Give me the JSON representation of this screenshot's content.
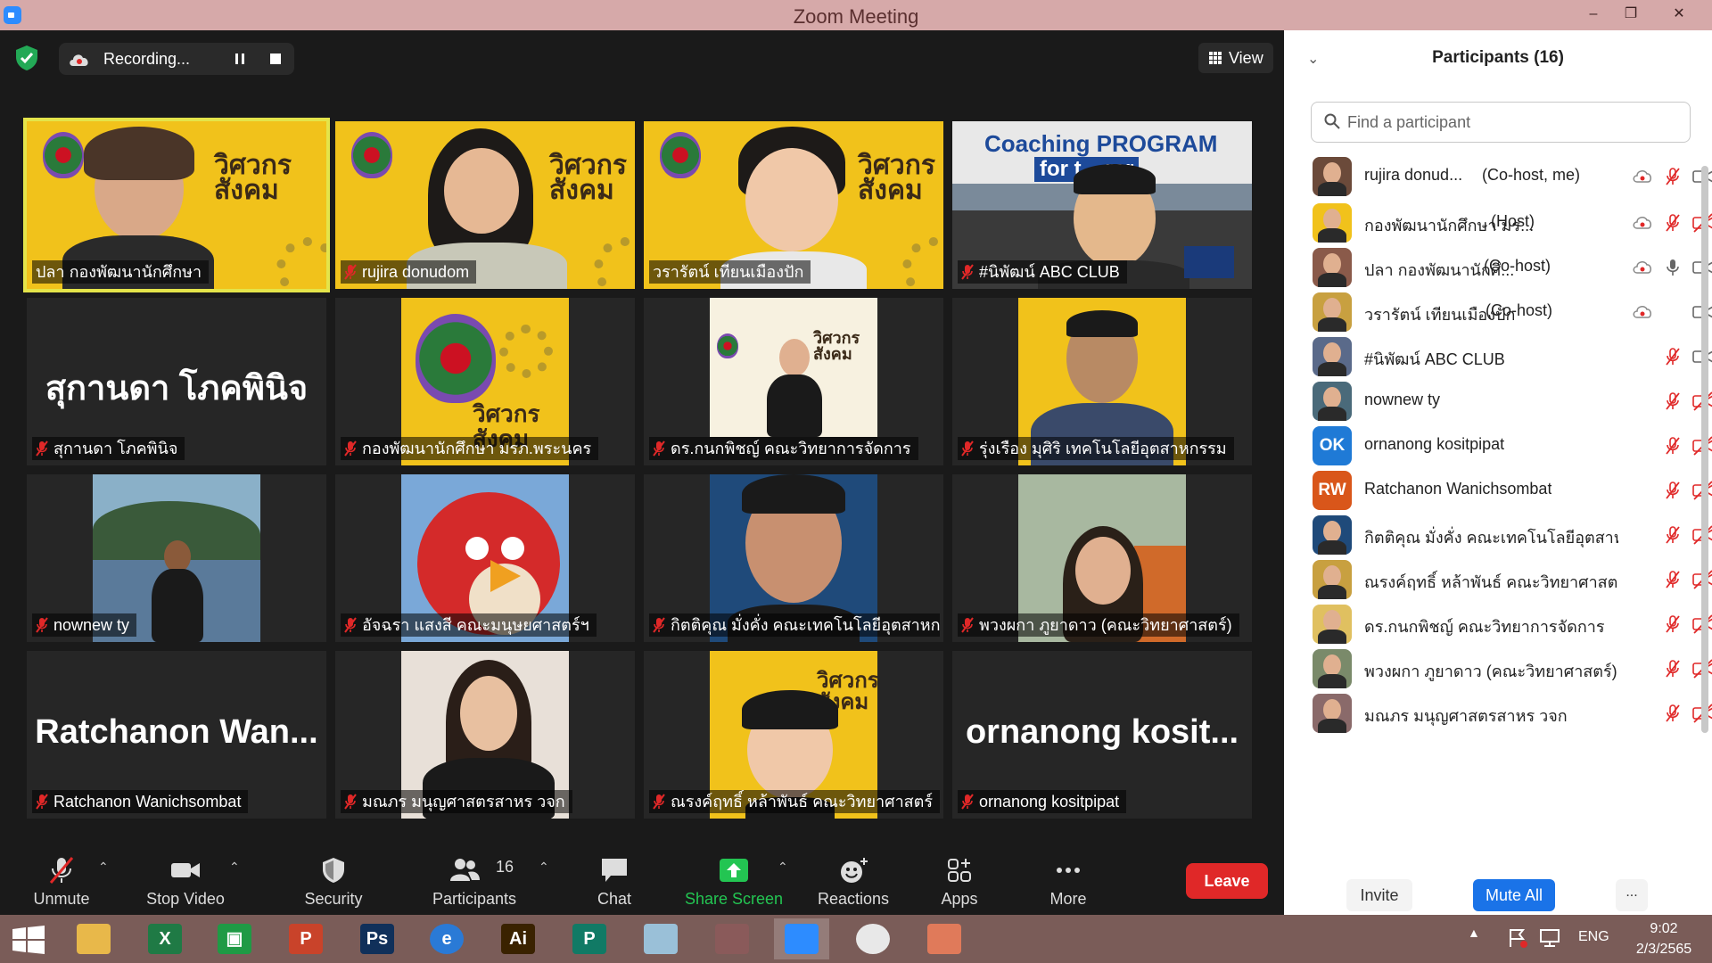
{
  "window": {
    "title": "Zoom Meeting",
    "controls": [
      "–",
      "❐",
      "✕"
    ]
  },
  "top_bar": {
    "recording_label": "Recording...",
    "view_label": "View"
  },
  "tiles": [
    {
      "name": "ปลา กองพัฒนานักศึกษา",
      "mic": "on",
      "active": true
    },
    {
      "name": "rujira donudom",
      "mic": "muted"
    },
    {
      "name": "วรารัตน์ เทียนเมืองปัก",
      "mic": "on"
    },
    {
      "name": "#นิพัฒน์ ABC CLUB",
      "mic": "muted",
      "banner": "Coaching PROGRAM",
      "banner2": "for t    rer"
    },
    {
      "name": "สุกานดา โภคพินิจ",
      "mic": "muted",
      "big": "สุกานดา โภคพินิจ"
    },
    {
      "name": "กองพัฒนานักศึกษา มรภ.พระนคร",
      "mic": "muted"
    },
    {
      "name": "ดร.กนกพิชญ์ คณะวิทยาการจัดการ",
      "mic": "muted"
    },
    {
      "name": "รุ่งเรือง มุศิริ เทคโนโลยีอุตสาหกรรม",
      "mic": "muted"
    },
    {
      "name": "nownew ty",
      "mic": "muted"
    },
    {
      "name": "อัจฉรา แสงสี คณะมนุษยศาสตร์ฯ",
      "mic": "muted"
    },
    {
      "name": "กิตติคุณ มั่งคั่ง คณะเทคโนโลยีอุตสาหกรรม",
      "mic": "muted"
    },
    {
      "name": "พวงผกา ภูยาดาว (คณะวิทยาศาสตร์)",
      "mic": "muted"
    },
    {
      "name": "Ratchanon Wanichsombat",
      "mic": "muted",
      "big": "Ratchanon  Wan..."
    },
    {
      "name": "มณภร มนุญศาสตรสาหร วจก",
      "mic": "muted"
    },
    {
      "name": "ณรงค์ฤทธิ์ หล้าพันธ์ คณะวิทยาศาสตร์",
      "mic": "muted"
    },
    {
      "name": "ornanong kositpipat",
      "mic": "muted",
      "big": "ornanong  kosit..."
    }
  ],
  "banner_text": {
    "line1": "วิศวกร",
    "line2": "สังคม"
  },
  "toolbar": {
    "unmute": "Unmute",
    "stop_video": "Stop Video",
    "security": "Security",
    "participants": "Participants",
    "participants_count": "16",
    "chat": "Chat",
    "share_screen": "Share Screen",
    "reactions": "Reactions",
    "apps": "Apps",
    "more": "More",
    "leave": "Leave"
  },
  "panel": {
    "title": "Participants (16)",
    "search_placeholder": "Find a participant",
    "invite": "Invite",
    "mute_all": "Mute All",
    "more": "...",
    "participants": [
      {
        "name": "rujira donud...",
        "role": "(Co-host, me)",
        "cloud": true,
        "mic": "muted",
        "video": "on",
        "avatar": "photo",
        "color": "#6b4a3a"
      },
      {
        "name": "กองพัฒนานักศึกษา มร...",
        "role": "(Host)",
        "cloud": true,
        "mic": "muted",
        "video": "off",
        "avatar": "crest",
        "color": "#f1c21b"
      },
      {
        "name": "ปลา กองพัฒนานักศึ...",
        "role": "(Co-host)",
        "cloud": true,
        "mic": "on",
        "video": "on",
        "avatar": "photo",
        "color": "#8a5a4a"
      },
      {
        "name": "วรารัตน์ เทียนเมืองปัก",
        "role": "(Co-host)",
        "cloud": true,
        "mic": "none",
        "video": "on",
        "avatar": "photo",
        "color": "#c8a040"
      },
      {
        "name": "#นิพัฒน์ ABC CLUB",
        "role": "",
        "cloud": false,
        "mic": "muted",
        "video": "on",
        "avatar": "photo",
        "color": "#5a6a8a"
      },
      {
        "name": "nownew ty",
        "role": "",
        "cloud": false,
        "mic": "muted",
        "video": "off",
        "avatar": "photo",
        "color": "#4a6a7a"
      },
      {
        "name": "ornanong kositpipat",
        "role": "",
        "cloud": false,
        "mic": "muted",
        "video": "off",
        "avatar": "OK",
        "color": "#1f7ad6"
      },
      {
        "name": "Ratchanon Wanichsombat",
        "role": "",
        "cloud": false,
        "mic": "muted",
        "video": "off",
        "avatar": "RW",
        "color": "#d9561a"
      },
      {
        "name": "กิตติคุณ มั่งคั่ง คณะเทคโนโลยีอุตสาห...",
        "role": "",
        "cloud": false,
        "mic": "muted",
        "video": "off",
        "avatar": "photo",
        "color": "#1f4a7a"
      },
      {
        "name": "ณรงค์ฤทธิ์ หล้าพันธ์ คณะวิทยาศาสตร์",
        "role": "",
        "cloud": false,
        "mic": "muted",
        "video": "off",
        "avatar": "photo",
        "color": "#c8a040"
      },
      {
        "name": "ดร.กนกพิชญ์ คณะวิทยาการจัดการ",
        "role": "",
        "cloud": false,
        "mic": "muted",
        "video": "off",
        "avatar": "photo",
        "color": "#e0c060"
      },
      {
        "name": "พวงผกา ภูยาดาว (คณะวิทยาศาสตร์)",
        "role": "",
        "cloud": false,
        "mic": "muted",
        "video": "off",
        "avatar": "photo",
        "color": "#7a8a6a"
      },
      {
        "name": "มณภร มนุญศาสตรสาหร วจก",
        "role": "",
        "cloud": false,
        "mic": "muted",
        "video": "off",
        "avatar": "photo",
        "color": "#8a6a6a"
      }
    ]
  },
  "taskbar": {
    "apps": [
      {
        "name": "file-explorer",
        "glyph": "",
        "color": "#e8b84a"
      },
      {
        "name": "excel",
        "glyph": "X",
        "color": "#1f7a45"
      },
      {
        "name": "store",
        "glyph": "▣",
        "color": "#1f9a45"
      },
      {
        "name": "powerpoint",
        "glyph": "P",
        "color": "#c9432a"
      },
      {
        "name": "photoshop",
        "glyph": "Ps",
        "color": "#10305a"
      },
      {
        "name": "internet-explorer",
        "glyph": "e",
        "color": "#2a7ad6"
      },
      {
        "name": "illustrator",
        "glyph": "Ai",
        "color": "#3a2200"
      },
      {
        "name": "publisher",
        "glyph": "P",
        "color": "#117a65"
      },
      {
        "name": "paper",
        "glyph": "",
        "color": "#9ac0d8"
      },
      {
        "name": "photoscape",
        "glyph": "",
        "color": "#8a5a5a"
      },
      {
        "name": "zoom",
        "glyph": "",
        "color": "#2d8cff"
      },
      {
        "name": "chrome",
        "glyph": "",
        "color": "#e8e8e8"
      },
      {
        "name": "image-viewer",
        "glyph": "",
        "color": "#e07a5a"
      }
    ],
    "language": "ENG",
    "time": "9:02",
    "date": "2/3/2565"
  }
}
